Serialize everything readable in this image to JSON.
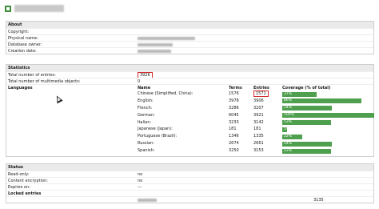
{
  "window": {
    "icon": "document-icon"
  },
  "about": {
    "heading": "About",
    "rows": [
      {
        "label": "Copyright:"
      },
      {
        "label": "Physical name:"
      },
      {
        "label": "Database owner:"
      },
      {
        "label": "Creation date:"
      }
    ]
  },
  "statistics": {
    "heading": "Statistics",
    "total_entries_label": "Total number of entries:",
    "total_entries_value": "3926",
    "multimedia_label": "Total number of multimedia objects:",
    "multimedia_value": "0",
    "languages_label": "Languages",
    "columns": {
      "name": "Name",
      "terms": "Terms",
      "entries": "Entries",
      "coverage": "Coverage (% of total)"
    },
    "languages": [
      {
        "name": "Chinese (Simplified, China):",
        "terms": "1576",
        "entries": "1571",
        "coverage_label": "37%",
        "coverage": 0.37
      },
      {
        "name": "English:",
        "terms": "3978",
        "entries": "3906",
        "coverage_label": "86%",
        "coverage": 0.86
      },
      {
        "name": "French:",
        "terms": "3286",
        "entries": "3207",
        "coverage_label": "54%",
        "coverage": 0.54
      },
      {
        "name": "German:",
        "terms": "6045",
        "entries": "3921",
        "coverage_label": "100%",
        "coverage": 1.0
      },
      {
        "name": "Italian:",
        "terms": "3233",
        "entries": "3142",
        "coverage_label": "53%",
        "coverage": 0.53
      },
      {
        "name": "Japanese (Japan):",
        "terms": "181",
        "entries": "181",
        "coverage_label": "5%",
        "coverage": 0.05
      },
      {
        "name": "Portuguese (Brazil):",
        "terms": "1346",
        "entries": "1335",
        "coverage_label": "22%",
        "coverage": 0.22
      },
      {
        "name": "Russian:",
        "terms": "2674",
        "entries": "2661",
        "coverage_label": "54%",
        "coverage": 0.54
      },
      {
        "name": "Spanish:",
        "terms": "3250",
        "entries": "3153",
        "coverage_label": "53%",
        "coverage": 0.53
      }
    ],
    "bar_color": "#4e9f4e",
    "highlight_color": "#d42c2c"
  },
  "status": {
    "heading": "Status",
    "rows": [
      {
        "label": "Read-only:",
        "value": "no"
      },
      {
        "label": "Content encryption:",
        "value": "no"
      },
      {
        "label": "Expires on:",
        "value": "---"
      }
    ],
    "locked_label": "Locked entries",
    "locked_value": "3135"
  }
}
